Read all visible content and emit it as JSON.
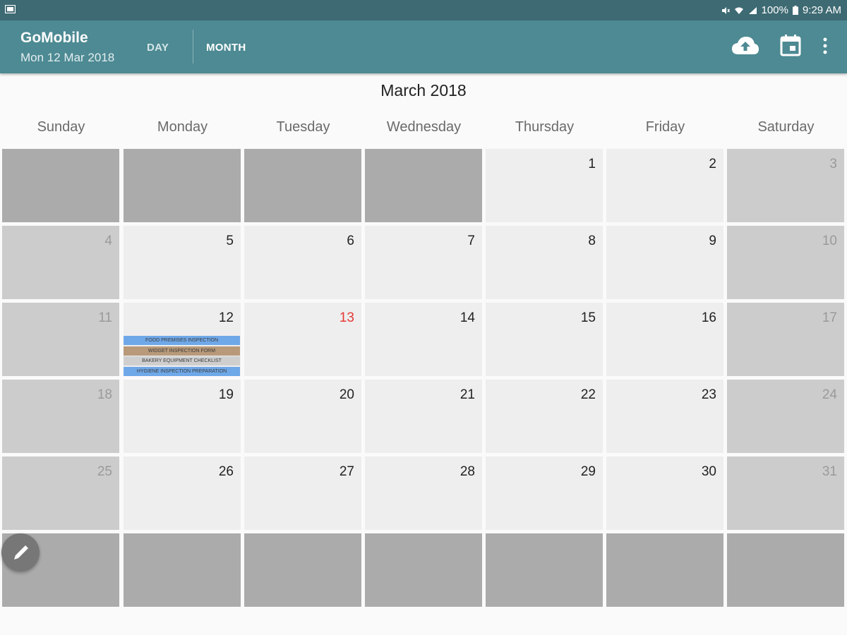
{
  "status_bar": {
    "battery": "100%",
    "time": "9:29 AM"
  },
  "toolbar": {
    "app_title": "GoMobile",
    "current_date": "Mon 12 Mar 2018",
    "tabs": [
      {
        "label": "DAY",
        "active": false
      },
      {
        "label": "MONTH",
        "active": true
      }
    ],
    "icons": [
      "cloud-upload-icon",
      "calendar-icon",
      "more-vertical-icon"
    ]
  },
  "calendar": {
    "month_title": "March 2018",
    "weekdays": [
      "Sunday",
      "Monday",
      "Tuesday",
      "Wednesday",
      "Thursday",
      "Friday",
      "Saturday"
    ],
    "today": "13",
    "weeks": [
      [
        "",
        "",
        "",
        "",
        "1",
        "2",
        "3"
      ],
      [
        "4",
        "5",
        "6",
        "7",
        "8",
        "9",
        "10"
      ],
      [
        "11",
        "12",
        "13",
        "14",
        "15",
        "16",
        "17"
      ],
      [
        "18",
        "19",
        "20",
        "21",
        "22",
        "23",
        "24"
      ],
      [
        "25",
        "26",
        "27",
        "28",
        "29",
        "30",
        "31"
      ],
      [
        "",
        "",
        "",
        "",
        "",
        "",
        ""
      ]
    ],
    "events_day": "12",
    "events": [
      {
        "label": "FOOD PREMISES INSPECTION",
        "color": "#6fa8e8"
      },
      {
        "label": "WIDGET INSPECTION FORM",
        "color": "#b89a7a"
      },
      {
        "label": "BAKERY EQUIPMENT CHECKLIST",
        "color": "#cfcfcf"
      },
      {
        "label": "HYGIENE INSPECTION PREPARATION",
        "color": "#6fa8e8"
      }
    ]
  },
  "colors": {
    "status_bar": "#3e6a73",
    "toolbar": "#4d8a93",
    "today_text": "#e53935",
    "empty_cell": "#ababab",
    "weekend_cell": "#cccccc",
    "weekday_cell": "#eeeeee"
  },
  "fab": {
    "icon": "pencil-icon"
  }
}
